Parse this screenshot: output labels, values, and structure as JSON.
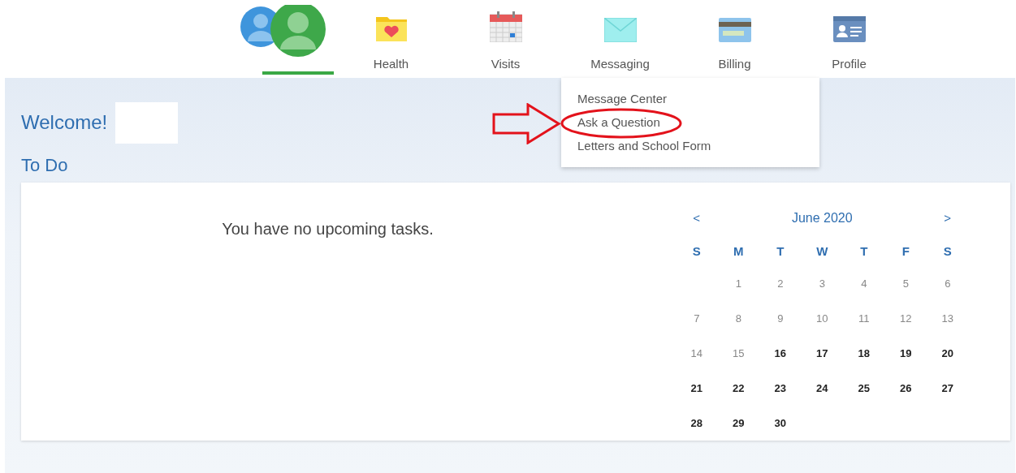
{
  "nav": {
    "tabs": [
      {
        "kind": "avatars",
        "selected": true
      },
      {
        "kind": "health",
        "label": "Health",
        "selected": false
      },
      {
        "kind": "visits",
        "label": "Visits",
        "selected": false
      },
      {
        "kind": "messaging",
        "label": "Messaging",
        "selected": false,
        "expanded": true
      },
      {
        "kind": "billing",
        "label": "Billing",
        "selected": false
      },
      {
        "kind": "profile",
        "label": "Profile",
        "selected": false
      }
    ]
  },
  "dropdown": {
    "items": [
      {
        "label": "Message Center",
        "highlighted": false
      },
      {
        "label": "Ask a Question",
        "highlighted": true
      },
      {
        "label": "Letters and School Form",
        "highlighted": false
      }
    ]
  },
  "welcome": {
    "title": "Welcome!"
  },
  "todo": {
    "title": "To Do",
    "empty_message": "You have no upcoming tasks."
  },
  "calendar": {
    "prev": "<",
    "month": "June 2020",
    "next": ">",
    "weekdays": [
      "S",
      "M",
      "T",
      "W",
      "T",
      "F",
      "S"
    ],
    "weeks": [
      {
        "fills_from_end": true,
        "days": [
          {
            "day": "1",
            "past": true
          },
          {
            "day": "2",
            "past": true
          },
          {
            "day": "3",
            "past": true
          },
          {
            "day": "4",
            "past": true
          },
          {
            "day": "5",
            "past": true
          },
          {
            "day": "6",
            "past": true
          }
        ]
      },
      {
        "days": [
          {
            "day": "7",
            "past": true
          },
          {
            "day": "8",
            "past": true
          },
          {
            "day": "9",
            "past": true
          },
          {
            "day": "10",
            "past": true
          },
          {
            "day": "11",
            "past": true
          },
          {
            "day": "12",
            "past": true
          },
          {
            "day": "13",
            "past": true
          }
        ]
      },
      {
        "days": [
          {
            "day": "14",
            "past": true
          },
          {
            "day": "15",
            "past": true
          },
          {
            "day": "16",
            "past": false
          },
          {
            "day": "17",
            "past": false
          },
          {
            "day": "18",
            "past": false
          },
          {
            "day": "19",
            "past": false
          },
          {
            "day": "20",
            "past": false
          }
        ]
      },
      {
        "days": [
          {
            "day": "21",
            "past": false
          },
          {
            "day": "22",
            "past": false
          },
          {
            "day": "23",
            "past": false
          },
          {
            "day": "24",
            "past": false
          },
          {
            "day": "25",
            "past": false
          },
          {
            "day": "26",
            "past": false
          },
          {
            "day": "27",
            "past": false
          }
        ]
      },
      {
        "days": [
          {
            "day": "28",
            "past": false
          },
          {
            "day": "29",
            "past": false
          },
          {
            "day": "30",
            "past": false
          }
        ]
      }
    ]
  }
}
